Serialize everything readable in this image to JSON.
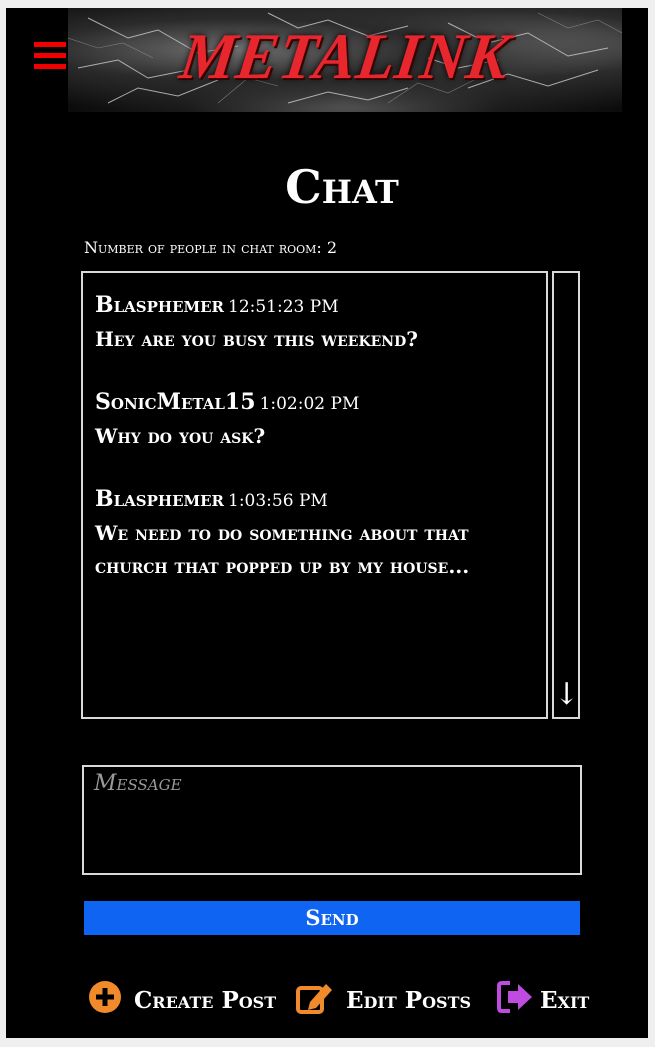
{
  "header": {
    "logo_text": "METALINK",
    "menu_icon": "hamburger-menu-icon",
    "menu_color": "#f20000",
    "logo_color": "#e8262e"
  },
  "page": {
    "title": "Chat",
    "people_count_text": "Number of people in chat room: 2"
  },
  "chat": {
    "messages": [
      {
        "user": "Blasphemer",
        "time": "12:51:23 PM",
        "text": "Hey are you busy this weekend?"
      },
      {
        "user": "SonicMetal15",
        "time": "1:02:02 PM",
        "text": "Why do you ask?"
      },
      {
        "user": "Blasphemer",
        "time": "1:03:56 PM",
        "text": "We need to do something about that church that popped up by my house..."
      }
    ],
    "scroll_icon": "arrow-down-icon"
  },
  "compose": {
    "placeholder": "Message",
    "send_label": "Send",
    "send_color": "#0f64f2"
  },
  "footer": {
    "create_label": "Create Post",
    "create_icon": "plus-circle-icon",
    "create_color": "#f08a2a",
    "edit_label": "Edit Posts",
    "edit_icon": "edit-icon",
    "edit_color": "#f08a2a",
    "exit_label": "Exit",
    "exit_icon": "sign-out-icon",
    "exit_color": "#c04be0"
  }
}
